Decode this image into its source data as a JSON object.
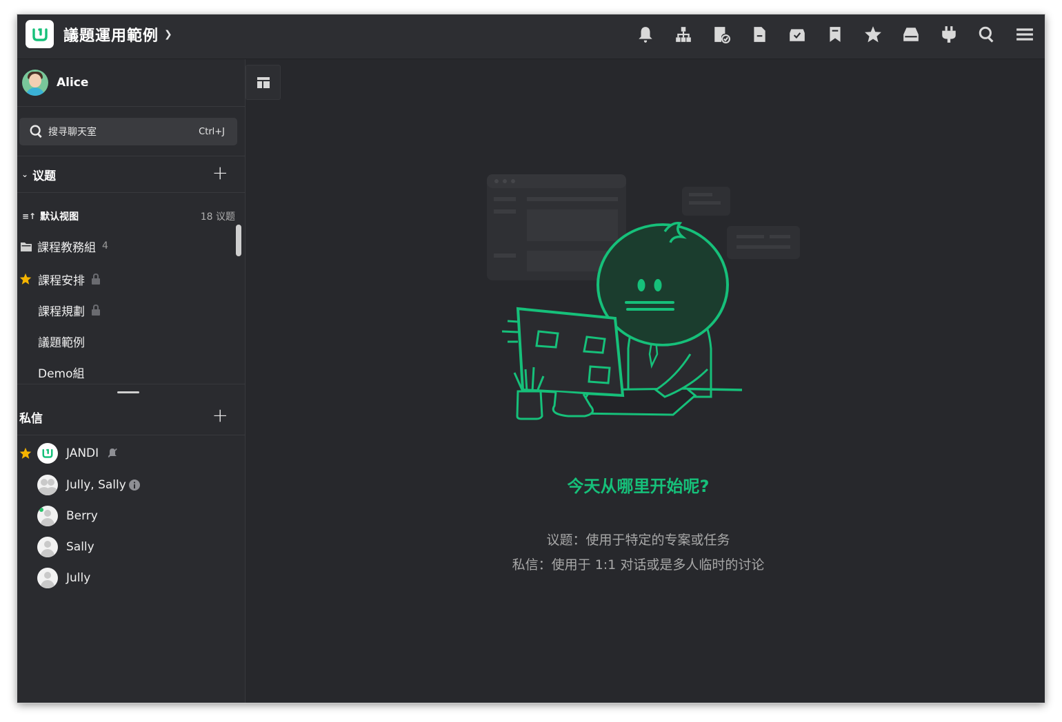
{
  "team": {
    "name": "議題運用範例"
  },
  "user": {
    "name": "Alice"
  },
  "search": {
    "placeholder": "搜寻聊天室",
    "shortcut": "Ctrl+J"
  },
  "topics_section": {
    "title": "议题",
    "view_label": "默认视图",
    "view_count": "18 议题",
    "folder": {
      "label": "課程教務組",
      "count": "4"
    },
    "items": [
      {
        "label": "課程安排",
        "starred": true,
        "locked": true
      },
      {
        "label": "課程規劃",
        "starred": false,
        "locked": true
      },
      {
        "label": "議題範例",
        "starred": false,
        "locked": false
      },
      {
        "label": "Demo組",
        "starred": false,
        "locked": false
      }
    ]
  },
  "dm_section": {
    "title": "私信",
    "items": [
      {
        "label": "JANDI",
        "starred": true,
        "badge": "muted-icon"
      },
      {
        "label": "Jully, Sally",
        "starred": false,
        "badge": "info-icon"
      },
      {
        "label": "Berry",
        "starred": false,
        "badge": ""
      },
      {
        "label": "Sally",
        "starred": false,
        "badge": ""
      },
      {
        "label": "Jully",
        "starred": false,
        "badge": ""
      }
    ]
  },
  "main": {
    "headline": "今天从哪里开始呢?",
    "desc1": "议题：使用于特定的专案或任务",
    "desc2": "私信：使用于 1:1 对话或是多人临时的讨论"
  },
  "colors": {
    "accent": "#16c07a",
    "star": "#f5b400",
    "background": "#27282c",
    "sidebar": "#2a2b2f"
  }
}
